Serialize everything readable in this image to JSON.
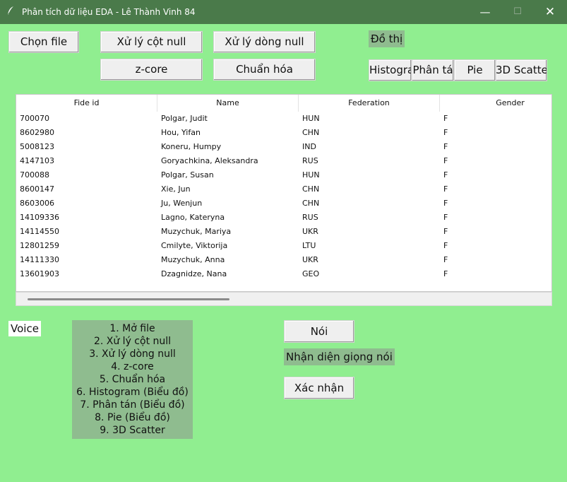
{
  "window": {
    "title": "Phân tích dữ liệu EDA - Lê Thành Vinh 84",
    "minimize": "—",
    "maximize": "☐",
    "close": "✕"
  },
  "toolbar": {
    "choose_file": "Chọn file",
    "null_columns": "Xử lý cột null",
    "null_rows": "Xử lý dòng null",
    "zcore": "z-core",
    "normalize": "Chuẩn hóa",
    "chart_label": "Đồ thị",
    "histogram": "Histogra",
    "scatter": "Phân tá",
    "pie": "Pie",
    "scatter3d": "3D Scatter"
  },
  "table": {
    "columns": [
      "Fide id",
      "Name",
      "Federation",
      "Gender"
    ],
    "rows": [
      [
        "700070",
        "Polgar, Judit",
        "HUN",
        "F"
      ],
      [
        "8602980",
        "Hou, Yifan",
        "CHN",
        "F"
      ],
      [
        "5008123",
        "Koneru, Humpy",
        "IND",
        "F"
      ],
      [
        "4147103",
        "Goryachkina, Aleksandra",
        "RUS",
        "F"
      ],
      [
        "700088",
        "Polgar, Susan",
        "HUN",
        "F"
      ],
      [
        "8600147",
        "Xie, Jun",
        "CHN",
        "F"
      ],
      [
        "8603006",
        "Ju, Wenjun",
        "CHN",
        "F"
      ],
      [
        "14109336",
        "Lagno, Kateryna",
        "RUS",
        "F"
      ],
      [
        "14114550",
        "Muzychuk, Mariya",
        "UKR",
        "F"
      ],
      [
        "12801259",
        "Cmilyte, Viktorija",
        "LTU",
        "F"
      ],
      [
        "14111330",
        "Muzychuk, Anna",
        "UKR",
        "F"
      ],
      [
        "13601903",
        "Dzagnidze, Nana",
        "GEO",
        "F"
      ]
    ]
  },
  "voice": {
    "label": "Voice",
    "commands": [
      "1. Mở file",
      "2. Xử lý cột null",
      "3. Xử lý dòng null",
      "4. z-core",
      "5. Chuẩn hóa",
      "6. Histogram (Biểu đồ)",
      "7. Phân tán (Biểu đồ)",
      "8. Pie (Biểu đồ)",
      "9. 3D Scatter"
    ],
    "speak_button": "Nói",
    "recognition_label": "Nhận diện giọng nói",
    "confirm_button": "Xác nhận"
  },
  "colors": {
    "background": "#90ee90",
    "title_bar": "#4a7a4a",
    "panel": "#8fbc8f",
    "button": "#efefef"
  }
}
